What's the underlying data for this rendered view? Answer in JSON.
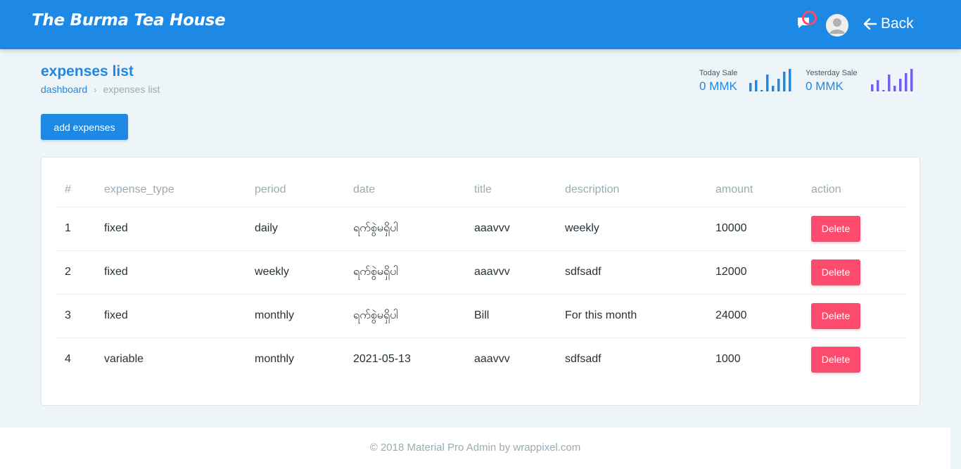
{
  "app": {
    "brand": "The Burma Tea House",
    "back_label": "Back"
  },
  "page": {
    "title": "expenses list",
    "breadcrumb": [
      "dashboard",
      "expenses list"
    ],
    "add_button": "add expenses"
  },
  "stats": {
    "today": {
      "label": "Today Sale",
      "value": "0 MMK",
      "color": "#1e88e5"
    },
    "yesterday": {
      "label": "Yesterday Sale",
      "value": "0 MMK",
      "color": "#7460ee"
    }
  },
  "table": {
    "headers": [
      "#",
      "expense_type",
      "period",
      "date",
      "title",
      "description",
      "amount",
      "action"
    ],
    "rows": [
      {
        "no": "1",
        "expense_type": "fixed",
        "period": "daily",
        "date": "ရက်စွဲမရှိပါ",
        "title": "aaavvv",
        "description": "weekly",
        "amount": "10000",
        "action": "Delete"
      },
      {
        "no": "2",
        "expense_type": "fixed",
        "period": "weekly",
        "date": "ရက်စွဲမရှိပါ",
        "title": "aaavvv",
        "description": "sdfsadf",
        "amount": "12000",
        "action": "Delete"
      },
      {
        "no": "3",
        "expense_type": "fixed",
        "period": "monthly",
        "date": "ရက်စွဲမရှိပါ",
        "title": "Bill",
        "description": "For this month",
        "amount": "24000",
        "action": "Delete"
      },
      {
        "no": "4",
        "expense_type": "variable",
        "period": "monthly",
        "date": "2021-05-13",
        "title": "aaavvv",
        "description": "sdfsadf",
        "amount": "1000",
        "action": "Delete"
      }
    ]
  },
  "footer": {
    "text": "© 2018 Material Pro Admin by wrappixel.com"
  },
  "colors": {
    "primary": "#1e88e5",
    "danger": "#fc4b6c",
    "muted": "#99abb4",
    "background": "#eef5f9"
  },
  "icons": [
    "message-icon",
    "avatar-icon",
    "arrow-left-icon",
    "chevron-right-icon"
  ]
}
